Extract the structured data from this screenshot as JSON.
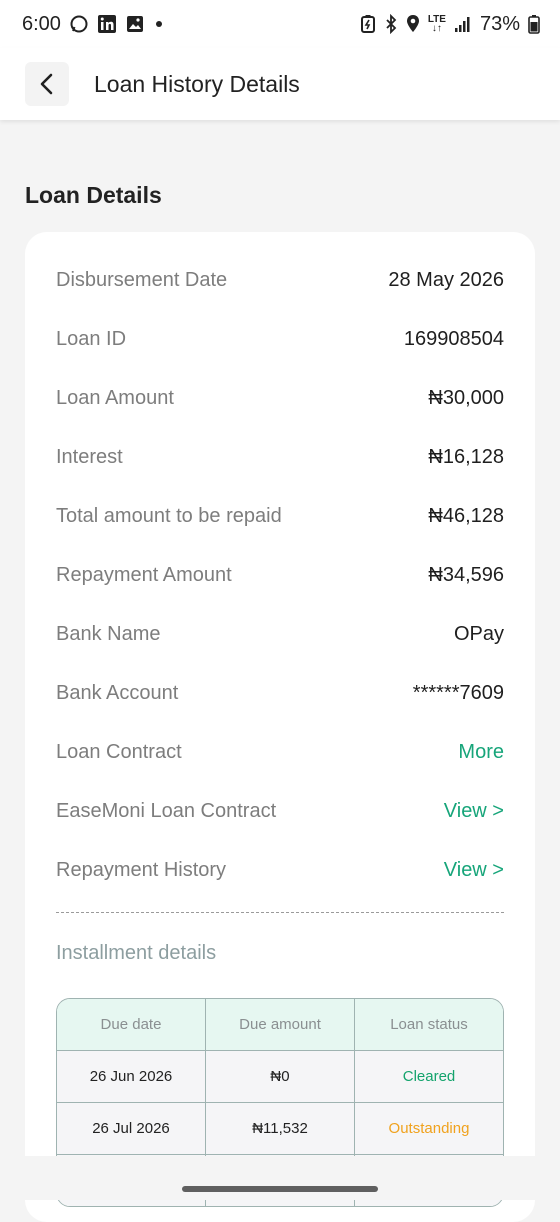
{
  "status_bar": {
    "time": "6:00",
    "network": "LTE",
    "battery": "73%",
    "icons_left": [
      "whatsapp-icon",
      "linkedin-icon",
      "gallery-icon",
      "dot-icon"
    ],
    "icons_right": [
      "battery-saver-icon",
      "bluetooth-icon",
      "location-icon",
      "lte-icon",
      "signal-icon",
      "battery-icon"
    ]
  },
  "header": {
    "title": "Loan History Details",
    "back_icon": "chevron-left-icon"
  },
  "section_title": "Loan Details",
  "details": [
    {
      "label": "Disbursement Date",
      "value": "28 May 2026",
      "kind": "text"
    },
    {
      "label": "Loan ID",
      "value": "169908504",
      "kind": "text"
    },
    {
      "label": "Loan Amount",
      "value": "₦30,000",
      "kind": "text"
    },
    {
      "label": "Interest",
      "value": "₦16,128",
      "kind": "text"
    },
    {
      "label": "Total amount to be repaid",
      "value": "₦46,128",
      "kind": "text"
    },
    {
      "label": "Repayment Amount",
      "value": "₦34,596",
      "kind": "text"
    },
    {
      "label": "Bank Name",
      "value": "OPay",
      "kind": "text"
    },
    {
      "label": "Bank Account",
      "value": "******7609",
      "kind": "text"
    },
    {
      "label": "Loan Contract",
      "value": "More",
      "kind": "link"
    },
    {
      "label": "EaseMoni Loan Contract",
      "value": "View >",
      "kind": "link"
    },
    {
      "label": "Repayment History",
      "value": "View >",
      "kind": "link"
    }
  ],
  "installments": {
    "title": "Installment details",
    "headers": [
      "Due date",
      "Due amount",
      "Loan status"
    ],
    "rows": [
      {
        "date": "26 Jun 2026",
        "amount": "₦0",
        "status": "Cleared"
      },
      {
        "date": "26 Jul 2026",
        "amount": "₦11,532",
        "status": "Outstanding"
      }
    ]
  },
  "colors": {
    "accent_green": "#17a57a",
    "cleared": "#13a36c",
    "outstanding": "#f0a21e",
    "table_header_bg": "#e6f7f1"
  }
}
